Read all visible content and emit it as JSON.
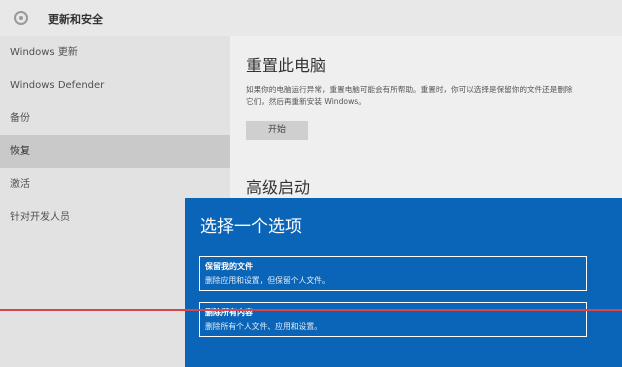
{
  "header": {
    "title": "更新和安全",
    "icon": "gear-icon"
  },
  "sidebar": {
    "items": [
      {
        "label": "Windows 更新"
      },
      {
        "label": "Windows Defender"
      },
      {
        "label": "备份"
      },
      {
        "label": "恢复"
      },
      {
        "label": "激活"
      },
      {
        "label": "针对开发人员"
      }
    ],
    "selected": "恢复"
  },
  "main": {
    "reset_title": "重置此电脑",
    "reset_desc": "如果你的电脑运行异常，重置电脑可能会有所帮助。重置时，你可以选择是保留你的文件还是删除它们，然后再重新安装 Windows。",
    "start_button": "开始",
    "advanced_title": "高级启动"
  },
  "overlay": {
    "title": "选择一个选项",
    "options": [
      {
        "title": "保留我的文件",
        "desc": "删除应用和设置，但保留个人文件。"
      },
      {
        "title": "删除所有内容",
        "desc": "删除所有个人文件、应用和设置。"
      }
    ]
  },
  "colors": {
    "overlay": "#0a64b8",
    "highlight": "#c9c9c9",
    "line": "#d8454a"
  }
}
